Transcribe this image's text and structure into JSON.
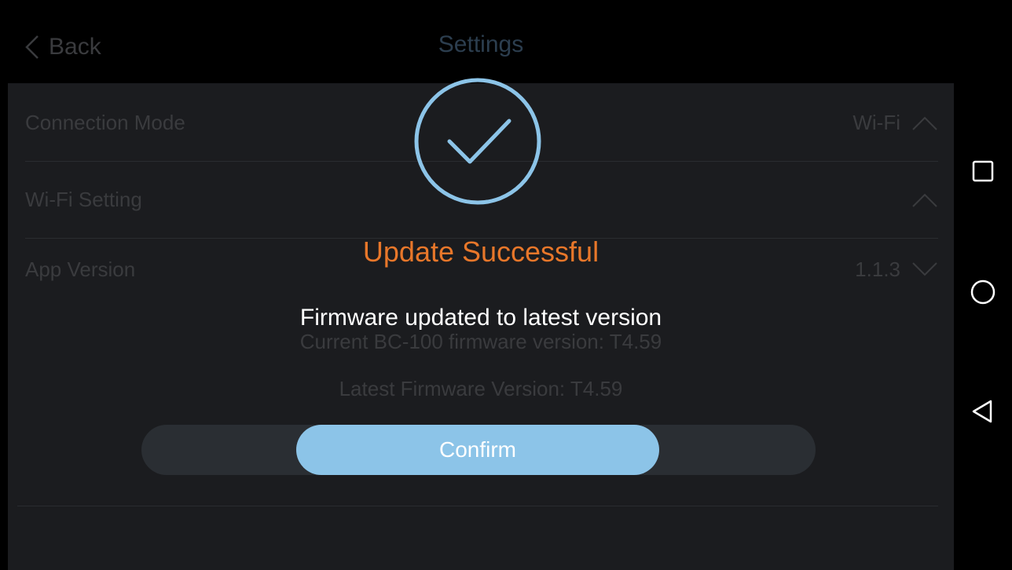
{
  "header": {
    "back_label": "Back",
    "title": "Settings"
  },
  "settings": {
    "rows": [
      {
        "label": "Connection Mode",
        "value": "Wi-Fi",
        "chevron": "chevron-up-icon"
      },
      {
        "label": "Wi-Fi Setting",
        "value": "",
        "chevron": "chevron-up-icon"
      },
      {
        "label": "App Version",
        "value": "1.1.3",
        "chevron": "chevron-down-icon"
      }
    ],
    "firmware_current": "Current BC-100 firmware version: T4.59",
    "firmware_latest": "Latest Firmware Version: T4.59"
  },
  "dialog": {
    "icon": "checkmark-circle-icon",
    "title": "Update Successful",
    "message": "Firmware updated to latest version",
    "confirm_label": "Confirm"
  },
  "navbar": {
    "icons": [
      "recents-square-icon",
      "home-circle-icon",
      "back-triangle-icon"
    ]
  },
  "colors": {
    "accent_blue": "#8cc4e8",
    "title_orange": "#e8772a",
    "background": "#1b1c1f"
  }
}
